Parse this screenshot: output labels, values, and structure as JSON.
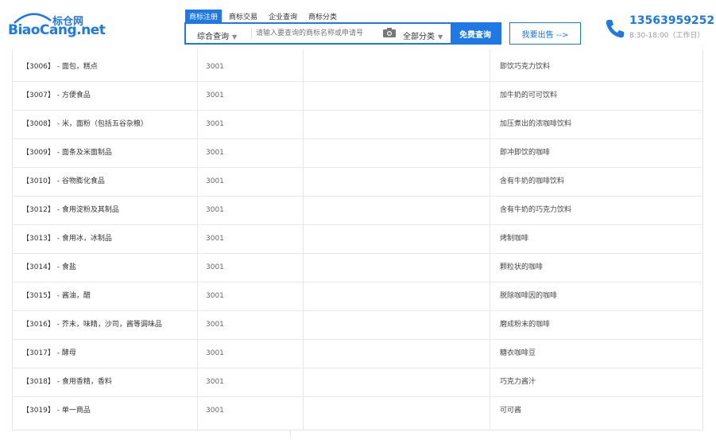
{
  "logo": {
    "cn": "标仓网",
    "en": "BiaoCang.net"
  },
  "tabs": [
    "商标注册",
    "商标交易",
    "企业查询",
    "商标分类"
  ],
  "search": {
    "type_label": "综合查询",
    "placeholder": "请输入要查询的商标名称或申请号",
    "category_label": "全部分类",
    "button_label": "免费查询"
  },
  "sell_label": "我要出售 -->",
  "contact": {
    "phone": "13563959252",
    "hours": "8:30-18:00（工作日）"
  },
  "colors": {
    "accent": "#1e78e6"
  },
  "table": {
    "rows": [
      {
        "group": "【3006】 - 面包，糕点",
        "num": "3001",
        "name": "即饮巧克力饮料"
      },
      {
        "group": "【3007】 - 方便食品",
        "num": "3001",
        "name": "加牛奶的可可饮料"
      },
      {
        "group": "【3008】 - 米，面粉（包括五谷杂粮）",
        "num": "3001",
        "name": "加压煮出的浓咖啡饮料"
      },
      {
        "group": "【3009】 - 面条及米面制品",
        "num": "3001",
        "name": "即冲即饮的咖啡"
      },
      {
        "group": "【3010】 - 谷物膨化食品",
        "num": "3001",
        "name": "含有牛奶的咖啡饮料"
      },
      {
        "group": "【3012】 - 食用淀粉及其制品",
        "num": "3001",
        "name": "含有牛奶的巧克力饮料"
      },
      {
        "group": "【3013】 - 食用冰，冰制品",
        "num": "3001",
        "name": "烤制咖啡"
      },
      {
        "group": "【3014】 - 食盐",
        "num": "3001",
        "name": "颗粒状的咖啡"
      },
      {
        "group": "【3015】 - 酱油，醋",
        "num": "3001",
        "name": "脱除咖啡因的咖啡"
      },
      {
        "group": "【3016】 - 芥末，味精，沙司，酱等调味品",
        "num": "3001",
        "name": "磨成粉末的咖啡"
      },
      {
        "group": "【3017】 - 酵母",
        "num": "3001",
        "name": "糖衣咖啡豆"
      },
      {
        "group": "【3018】 - 食用香精，香料",
        "num": "3001",
        "name": "巧克力酱汁"
      },
      {
        "group": "【3019】 - 单一商品",
        "num": "3001",
        "name": "可可酱"
      }
    ]
  }
}
